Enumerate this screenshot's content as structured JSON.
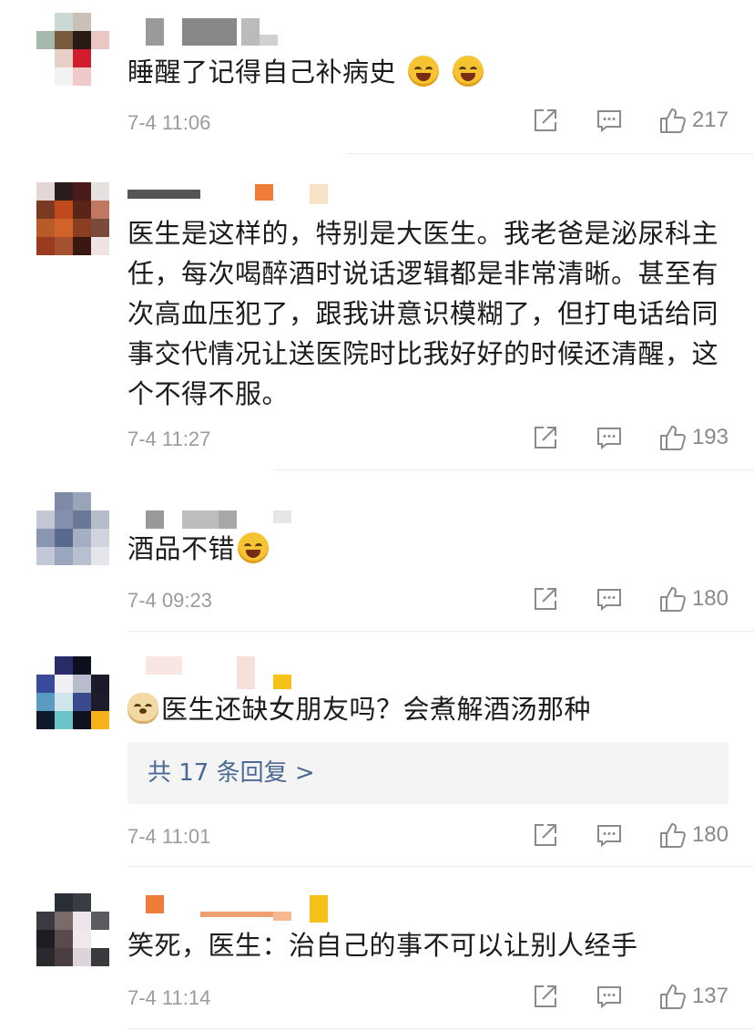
{
  "comments": [
    {
      "text": "睡醒了记得自己补病史",
      "emojis": [
        "rofl-emoji",
        "rofl-emoji"
      ],
      "time": "7-4 11:06",
      "likes": "217"
    },
    {
      "text": "医生是这样的，特别是大医生。我老爸是泌尿科主任，每次喝醉酒时说话逻辑都是非常清晰。甚至有次高血压犯了，跟我讲意识模糊了，但打电话给同事交代情况让送医院时比我好好的时候还清醒，这个不得不服。",
      "time": "7-4 11:27",
      "likes": "193"
    },
    {
      "text": "酒品不错",
      "emojis": [
        "crying-laughing-emoji"
      ],
      "time": "7-4 09:23",
      "likes": "180"
    },
    {
      "emojis": [
        "doge-emoji"
      ],
      "text": "医生还缺女朋友吗？会煮解酒汤那种",
      "replies": "共 17 条回复 >",
      "time": "7-4 11:01",
      "likes": "180"
    },
    {
      "text": "笑死，医生：治自己的事不可以让别人经手",
      "time": "7-4 11:14",
      "likes": "137"
    }
  ],
  "colors": {
    "link": "#4a6a95",
    "meta": "#9b9b9b",
    "divider": "#ececec"
  }
}
